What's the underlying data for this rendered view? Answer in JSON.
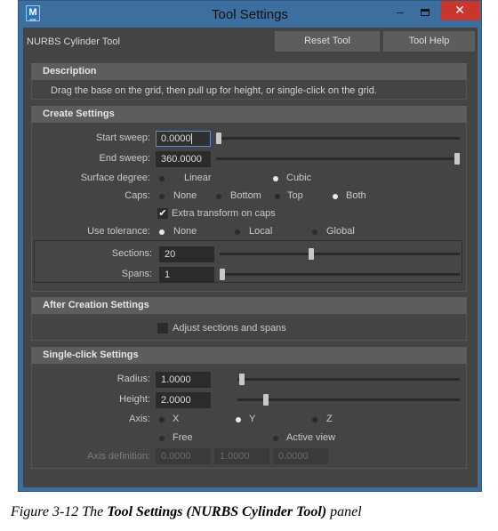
{
  "window": {
    "title": "Tool Settings",
    "app_icon_letter": "M",
    "app_icon_sub": "em",
    "minimize_glyph": "–",
    "close_glyph": "✕"
  },
  "toolbar": {
    "tool_name": "NURBS Cylinder Tool",
    "reset_label": "Reset Tool",
    "help_label": "Tool Help"
  },
  "description": {
    "header": "Description",
    "text": "Drag the base on the grid, then pull up for height, or single-click on the grid."
  },
  "create_settings": {
    "header": "Create Settings",
    "start_sweep": {
      "label": "Start sweep:",
      "value": "0.0000",
      "slider_fraction": 0.0
    },
    "end_sweep": {
      "label": "End sweep:",
      "value": "360.0000",
      "slider_fraction": 1.0
    },
    "surface_degree": {
      "label": "Surface degree:",
      "options": [
        "Linear",
        "Cubic"
      ],
      "selected": "Cubic"
    },
    "caps": {
      "label": "Caps:",
      "options": [
        "None",
        "Bottom",
        "Top",
        "Both"
      ],
      "selected": "Both"
    },
    "extra_transform": {
      "label": "Extra transform on caps",
      "checked": true
    },
    "use_tolerance": {
      "label": "Use tolerance:",
      "options": [
        "None",
        "Local",
        "Global"
      ],
      "selected": "None"
    },
    "sections": {
      "label": "Sections:",
      "value": "20"
    },
    "spans": {
      "label": "Spans:",
      "value": "1"
    }
  },
  "after_creation": {
    "header": "After Creation Settings",
    "adjust": {
      "label": "Adjust sections and spans",
      "checked": false
    }
  },
  "single_click": {
    "header": "Single-click Settings",
    "radius": {
      "label": "Radius:",
      "value": "1.0000"
    },
    "height": {
      "label": "Height:",
      "value": "2.0000"
    },
    "axis": {
      "label": "Axis:",
      "options": [
        "X",
        "Y",
        "Z",
        "Free",
        "Active view"
      ],
      "selected": "Y"
    },
    "axis_definition": {
      "label": "Axis definition:",
      "values": [
        "0.0000",
        "1.0000",
        "0.0000"
      ]
    }
  },
  "caption": {
    "prefix": "Figure 3-12  The ",
    "bold": "Tool Settings (NURBS Cylinder Tool)",
    "suffix": " panel"
  }
}
